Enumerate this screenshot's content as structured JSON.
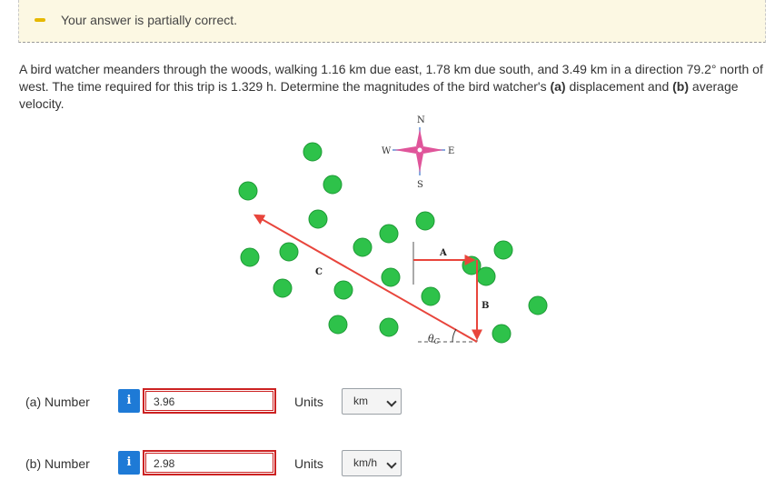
{
  "feedback": {
    "message": "Your answer is partially correct.",
    "status_color": "#e6b800"
  },
  "problem": {
    "part1": "A bird watcher meanders through the woods, walking 1.16 km due east, 1.78 km due south, and 3.49 km in a direction 79.2° north of west. The time required for this trip is 1.329 h. Determine the magnitudes of the bird watcher's ",
    "part_a_marker": "(a)",
    "part2": " displacement and ",
    "part_b_marker": "(b)",
    "part3": " average velocity."
  },
  "figure": {
    "compass": {
      "n": "N",
      "s": "S",
      "e": "E",
      "w": "W"
    },
    "vector_a": "A",
    "vector_b": "B",
    "vector_c": "C",
    "angle": "θ",
    "angle_sub": "C",
    "colors": {
      "arrow": "#e8453c",
      "tree": "#2ec24a",
      "compass": "#e0559a"
    }
  },
  "answers": [
    {
      "label": "(a)  Number",
      "info": "i",
      "value": "3.96",
      "units_label": "Units",
      "unit": "km"
    },
    {
      "label": "(b)  Number",
      "info": "i",
      "value": "2.98",
      "units_label": "Units",
      "unit": "km/h"
    }
  ]
}
